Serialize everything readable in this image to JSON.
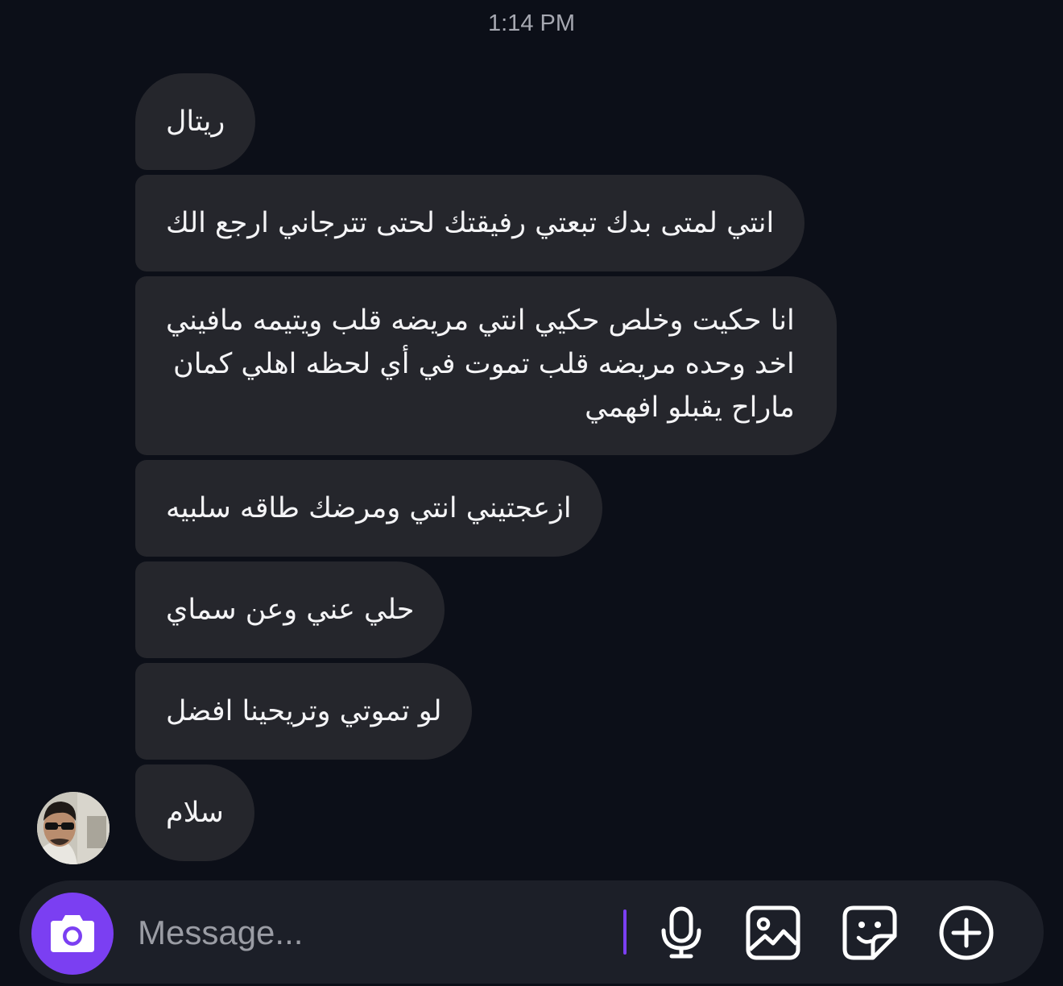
{
  "thread": {
    "timestamp": "1:14 PM",
    "messages": [
      {
        "lines": [
          "ريتال"
        ]
      },
      {
        "lines": [
          "انتي لمتى بدك تبعتي رفيقتك لحتى تترجاني ارجع الك"
        ]
      },
      {
        "lines": [
          "انا حكيت وخلص حكيي انتي مريضه قلب ويتيمه مافيني",
          "اخد وحده مريضه قلب تموت في أي لحظه اهلي كمان",
          "ماراح يقبلو افهمي"
        ]
      },
      {
        "lines": [
          "ازعجتيني انتي ومرضك طاقه سلبيه"
        ]
      },
      {
        "lines": [
          "حلي عني وعن سماي"
        ]
      },
      {
        "lines": [
          "لو تموتي وتريحينا افضل"
        ]
      },
      {
        "lines": [
          "سلام"
        ]
      }
    ]
  },
  "composer": {
    "placeholder": "Message...",
    "icons": [
      "camera-icon",
      "microphone-icon",
      "gallery-icon",
      "sticker-icon",
      "plus-circle-icon"
    ]
  },
  "colors": {
    "background": "#0c0f18",
    "bubble": "#25262c",
    "accent": "#7b3ff2",
    "composer": "#1c1f28"
  }
}
